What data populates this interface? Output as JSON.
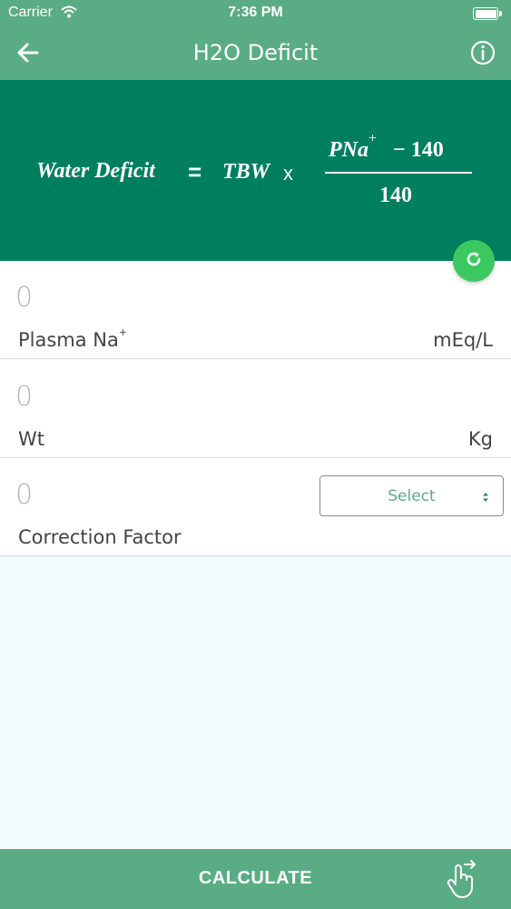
{
  "status_bar": {
    "carrier": "Carrier",
    "time": "7:36 PM"
  },
  "nav": {
    "title": "H2O Deficit",
    "back_icon": "arrow-left-icon",
    "info_icon": "info-circle-icon"
  },
  "formula": {
    "lhs": "Water Deficit",
    "equals": "=",
    "tbw": "TBW",
    "times": "x",
    "numerator_var": "PNa",
    "numerator_sup": "+",
    "numerator_rest": "− 140",
    "denominator": "140"
  },
  "refresh_icon": "refresh-icon",
  "fields": {
    "plasma_na": {
      "placeholder": "0",
      "label": "Plasma Na",
      "label_sup": "+",
      "unit": "mEq/L"
    },
    "weight": {
      "placeholder": "0",
      "label": "Wt",
      "unit": "Kg"
    },
    "correction": {
      "placeholder": "0",
      "label": "Correction Factor",
      "select_value": "Select"
    }
  },
  "bottom": {
    "calculate_label": "CALCULATE",
    "hand_icon": "tap-hand-icon"
  },
  "colors": {
    "header_green": "#5aac84",
    "formula_green": "#007f5f",
    "refresh_green": "#3cc860",
    "content_bg": "#f3fafc"
  }
}
